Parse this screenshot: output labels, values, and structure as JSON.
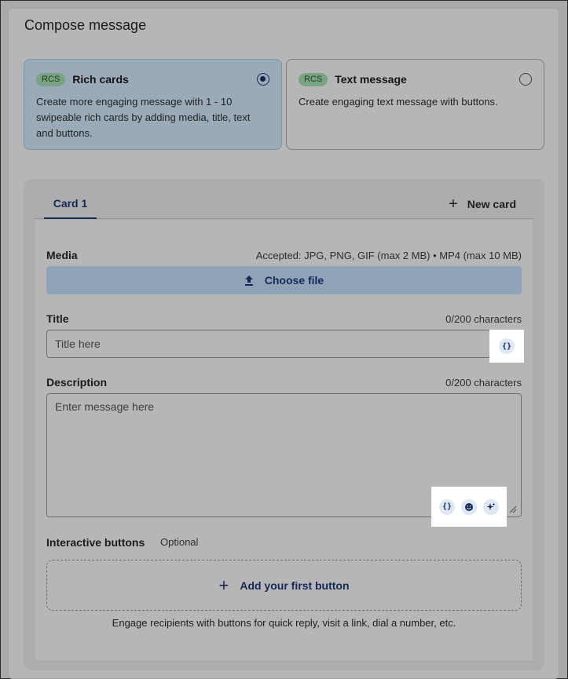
{
  "page": {
    "title": "Compose message"
  },
  "options": [
    {
      "pill": "RCS",
      "title": "Rich cards",
      "description": "Create more engaging message with 1 - 10 swipeable rich cards by adding media, title, text and buttons.",
      "selected": true
    },
    {
      "pill": "RCS",
      "title": "Text message",
      "description": "Create engaging text message with buttons.",
      "selected": false
    }
  ],
  "tabs": {
    "active": "Card 1",
    "new_card": "New card"
  },
  "media": {
    "label": "Media",
    "accepted": "Accepted: JPG, PNG, GIF (max 2 MB) • MP4 (max 10 MB)",
    "button": "Choose file"
  },
  "title_field": {
    "label": "Title",
    "counter": "0/200 characters",
    "placeholder": "Title here"
  },
  "description_field": {
    "label": "Description",
    "counter": "0/200 characters",
    "placeholder": "Enter message here"
  },
  "interactive": {
    "label": "Interactive buttons",
    "optional": "Optional",
    "add_button": "Add your first button",
    "hint": "Engage recipients with buttons for quick reply, visit a link, dial a number, etc."
  },
  "icons": {
    "variable": "variable-braces-icon",
    "emoji": "emoji-icon",
    "ai": "sparkle-icon",
    "upload": "upload-icon",
    "plus": "plus-icon"
  },
  "colors": {
    "accent": "#14285a",
    "pill_bg": "#7aa383",
    "selected_bg": "#9aaab8",
    "highlight": "#ffffff"
  }
}
